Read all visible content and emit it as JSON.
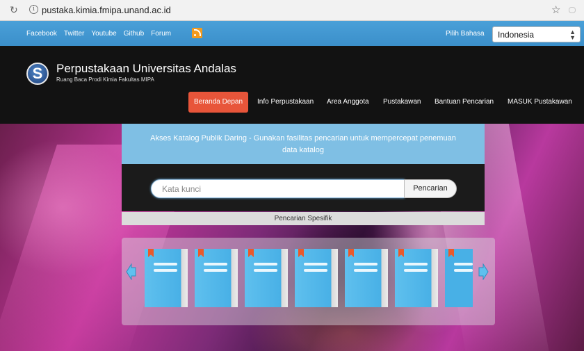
{
  "browser": {
    "url": "pustaka.kimia.fmipa.unand.ac.id"
  },
  "topbar": {
    "social_links": [
      "Facebook",
      "Twitter",
      "Youtube",
      "Github",
      "Forum"
    ],
    "language_label": "Pilih Bahasa",
    "language_selected": "Indonesia"
  },
  "header": {
    "title": "Perpustakaan Universitas Andalas",
    "subtitle": "Ruang Baca Prodi Kimia Fakultas MIPA"
  },
  "nav": {
    "items": [
      {
        "label": "Beranda Depan",
        "active": true
      },
      {
        "label": "Info Perpustakaan",
        "active": false
      },
      {
        "label": "Area Anggota",
        "active": false
      },
      {
        "label": "Pustakawan",
        "active": false
      },
      {
        "label": "Bantuan Pencarian",
        "active": false
      },
      {
        "label": "MASUK Pustakawan",
        "active": false
      }
    ]
  },
  "search": {
    "info_text": "Akses Katalog Publik Daring - Gunakan fasilitas pencarian untuk mempercepat penemuan data katalog",
    "placeholder": "Kata kunci",
    "button_label": "Pencarian",
    "specific_label": "Pencarian Spesifik"
  },
  "carousel": {
    "book_count": 7
  },
  "colors": {
    "topbar": "#3b8fca",
    "header": "#121212",
    "nav_active": "#e8553a",
    "catalog_info": "#7fbfe4",
    "book": "#48b0e6",
    "ribbon": "#e95a2c"
  }
}
